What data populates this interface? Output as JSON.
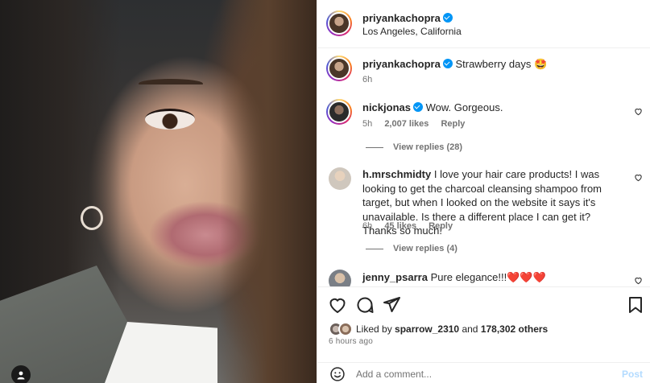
{
  "post": {
    "author": "priyankachopra",
    "location": "Los Angeles, California"
  },
  "caption": {
    "username": "priyankachopra",
    "text": "Strawberry days 🤩",
    "time": "6h"
  },
  "comments": [
    {
      "username": "nickjonas",
      "verified": true,
      "text": "Wow. Gorgeous.",
      "time": "5h",
      "likes": "2,007 likes",
      "reply_label": "Reply",
      "view_replies": "View replies (28)"
    },
    {
      "username": "h.mrschmidty",
      "verified": false,
      "text": "I love your hair care products! I was looking to get the charcoal cleansing shampoo from target, but when I looked on the website it says it's unavailable. Is there a different place I can get it? Thanks so much!",
      "time": "6h",
      "likes": "45 likes",
      "reply_label": "Reply",
      "view_replies": "View replies (4)"
    },
    {
      "username": "jenny_psarra",
      "verified": false,
      "text": "Pure elegance!!!❤️❤️❤️"
    }
  ],
  "likes": {
    "prefix": "Liked by",
    "user": "sparrow_2310",
    "connector": "and",
    "others": "178,302 others"
  },
  "timestamp": "6 hours ago",
  "comment_box": {
    "placeholder": "Add a comment...",
    "post_label": "Post"
  },
  "icons": {
    "like": "heart-icon",
    "comment": "comment-icon",
    "share": "send-icon",
    "save": "bookmark-icon",
    "emoji": "emoji-icon",
    "user_tag": "user-tag-icon"
  },
  "colors": {
    "verified": "#0095f6",
    "text": "#262626",
    "muted": "#737373",
    "post_disabled": "#b3dbff"
  }
}
